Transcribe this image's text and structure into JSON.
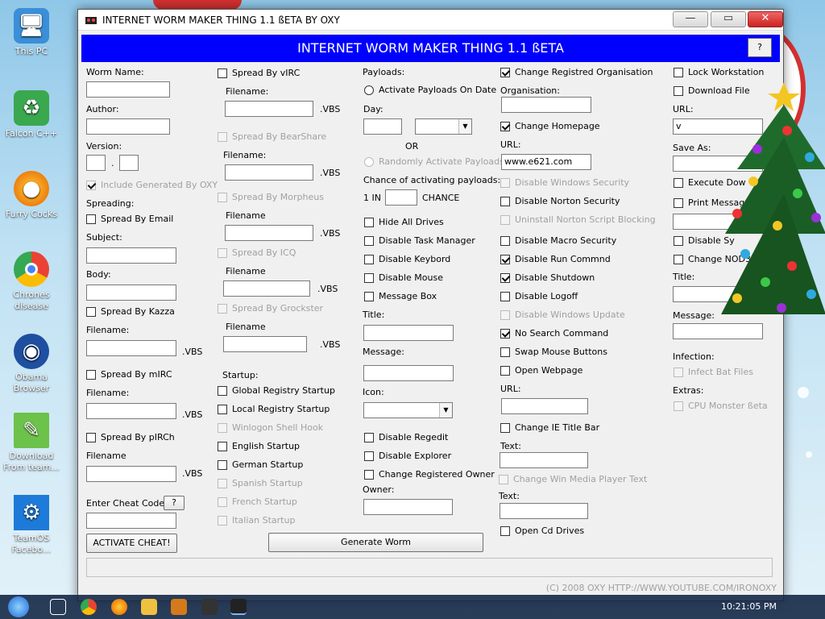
{
  "desktop": {
    "icons": [
      {
        "label": "This PC"
      },
      {
        "label": "Falcon C++"
      },
      {
        "label": "Furry Cocks"
      },
      {
        "label": "Chrones disease"
      },
      {
        "label": "Obama Browser"
      },
      {
        "label": "Download From team..."
      },
      {
        "label": "TeamOS Facebo..."
      }
    ]
  },
  "window": {
    "title": "INTERNET WORM MAKER THING 1.1 ßETA BY OXY",
    "banner": "INTERNET WORM MAKER THING 1.1 ßETA",
    "help_label": "?",
    "minimize_label": "—",
    "maximize_label": "▭",
    "close_label": "✕"
  },
  "col1": {
    "worm_name_label": "Worm Name:",
    "worm_name_value": "",
    "author_label": "Author:",
    "author_value": "",
    "version_label": "Version:",
    "version_sep": ".",
    "include_generated": "Include Generated By OXY",
    "spreading_label": "Spreading:",
    "spread_email": "Spread By Email",
    "subject_label": "Subject:",
    "body_label": "Body:",
    "spread_kazza": "Spread By Kazza",
    "filename_label1": "Filename:",
    "vbs1": ".VBS",
    "spread_mirc": "Spread By mIRC",
    "filename_label2": "Filename:",
    "vbs2": ".VBS",
    "spread_pirch": "Spread By pIRCh",
    "filename_label3": "Filename",
    "vbs3": ".VBS",
    "cheat_label": "Enter Cheat Code!",
    "cheat_help": "?",
    "activate_cheat": "ACTIVATE CHEAT!"
  },
  "col2": {
    "spread_virc": "Spread By vIRC",
    "filename_virc": "Filename:",
    "vbs_virc": ".VBS",
    "spread_bearshare": "Spread By BearShare",
    "filename_bearshare": "Filename:",
    "vbs_bearshare": ".VBS",
    "spread_morpheus": "Spread By Morpheus",
    "filename_morpheus": "Filename",
    "vbs_morpheus": ".VBS",
    "spread_icq": "Spread By ICQ",
    "filename_icq": "Filename",
    "vbs_icq": ".VBS",
    "spread_grockster": "Spread By Grockster",
    "filename_grockster": "Filename",
    "vbs_grockster": ".VBS",
    "startup_label": "Startup:",
    "global_registry": "Global Registry Startup",
    "local_registry": "Local Registry Startup",
    "winlogon": "Winlogon Shell Hook",
    "english": "English Startup",
    "german": "German Startup",
    "spanish": "Spanish Startup",
    "french": "French Startup",
    "italian": "Italian Startup",
    "generate": "Generate Worm"
  },
  "col3": {
    "payloads_label": "Payloads:",
    "activate_on_date": "Activate Payloads On Date",
    "day_label": "Day:",
    "or_label": "OR",
    "randomly_activate": "Randomly Activate Payloads",
    "chance_label": "Chance of activating payloads:",
    "one_in": "1 IN",
    "chance": "CHANCE",
    "hide_drives": "Hide All Drives",
    "disable_task": "Disable Task Manager",
    "disable_keyboard": "Disable Keybord",
    "disable_mouse": "Disable Mouse",
    "message_box": "Message Box",
    "title_label": "Title:",
    "message_label": "Message:",
    "icon_label": "Icon:",
    "disable_regedit": "Disable Regedit",
    "disable_explorer": "Disable Explorer",
    "change_owner": "Change Registered Owner",
    "owner_label": "Owner:"
  },
  "col4": {
    "change_org": "Change Registred Organisation",
    "organisation_label": "Organisation:",
    "change_homepage": "Change Homepage",
    "url_label": "URL:",
    "url_value": "www.e621.com",
    "disable_win_security": "Disable Windows Security",
    "disable_norton": "Disable Norton Security",
    "uninstall_norton": "Uninstall Norton Script Blocking",
    "disable_macro": "Disable Macro Security",
    "disable_run": "Disable Run Commnd",
    "disable_shutdown": "Disable Shutdown",
    "disable_logoff": "Disable Logoff",
    "disable_win_update": "Disable Windows Update",
    "no_search": "No Search Command",
    "swap_mouse": "Swap Mouse Buttons",
    "open_webpage": "Open Webpage",
    "url_label2": "URL:",
    "change_ie_title": "Change IE Title Bar",
    "text_label": "Text:",
    "change_wmp_text": "Change Win Media Player Text",
    "text_label2": "Text:",
    "open_cd": "Open Cd Drives"
  },
  "col5": {
    "lock_workstation": "Lock Workstation",
    "download_file": "Download File",
    "url_label": "URL:",
    "url_value": "v",
    "save_as_label": "Save As:",
    "execute_down": "Execute Dow",
    "print_message": "Print Message",
    "disable_sys": "Disable Sy",
    "change_nod32": "Change NOD32 T",
    "title_label": "Title:",
    "message_label": "Message:",
    "infection_label": "Infection:",
    "infect_bat": "Infect Bat Files",
    "extras_label": "Extras:",
    "cpu_monster": "CPU Monster ßeta"
  },
  "footer": {
    "copyright": "(C) 2008 OXY HTTP://WWW.YOUTUBE.COM/IRONOXY"
  },
  "taskbar": {
    "clock": "10:21:05 PM"
  },
  "colors": {
    "banner": "#0000ff",
    "window_bg": "#f0f0f0",
    "disabled_text": "#a0a0a0"
  }
}
